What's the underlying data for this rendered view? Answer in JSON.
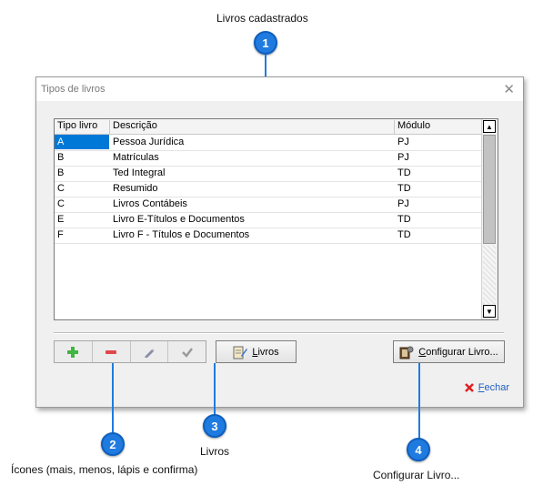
{
  "annotations": [
    {
      "number": "1",
      "caption": "Livros cadastrados"
    },
    {
      "number": "2",
      "caption": "Ícones (mais, menos, lápis e confirma)"
    },
    {
      "number": "3",
      "caption": "Livros"
    },
    {
      "number": "4",
      "caption": "Configurar Livro..."
    }
  ],
  "window": {
    "title": "Tipos de livros",
    "close_glyph": "✕"
  },
  "grid": {
    "columns": [
      "Tipo livro",
      "Descrição",
      "Módulo"
    ],
    "rows": [
      [
        "A",
        "Pessoa Jurídica",
        "PJ"
      ],
      [
        "B",
        "Matrículas",
        "PJ"
      ],
      [
        "B",
        "Ted Integral",
        "TD"
      ],
      [
        "C",
        "Resumido",
        "TD"
      ],
      [
        "C",
        "Livros Contábeis",
        "PJ"
      ],
      [
        "E",
        "Livro E-Títulos e Documentos",
        "TD"
      ],
      [
        "F",
        "Livro F - Títulos e Documentos",
        "TD"
      ]
    ]
  },
  "toolbar": {
    "icons": [
      "plus-icon",
      "minus-icon",
      "pencil-icon",
      "check-icon"
    ]
  },
  "buttons": {
    "livros": {
      "prefix": "",
      "underlined": "L",
      "suffix": "ivros",
      "icon": "book-pencil-icon"
    },
    "configurar": {
      "prefix": "",
      "underlined": "C",
      "suffix": "onfigurar Livro...",
      "icon": "book-gear-icon"
    },
    "fechar": {
      "underlined": "F",
      "suffix": "echar",
      "icon": "close-red-icon"
    }
  },
  "colors": {
    "accent": "#1f7be0",
    "selection": "#0078d7",
    "plus": "#3fb63f",
    "minus": "#e0464b",
    "close": "#e02020"
  }
}
